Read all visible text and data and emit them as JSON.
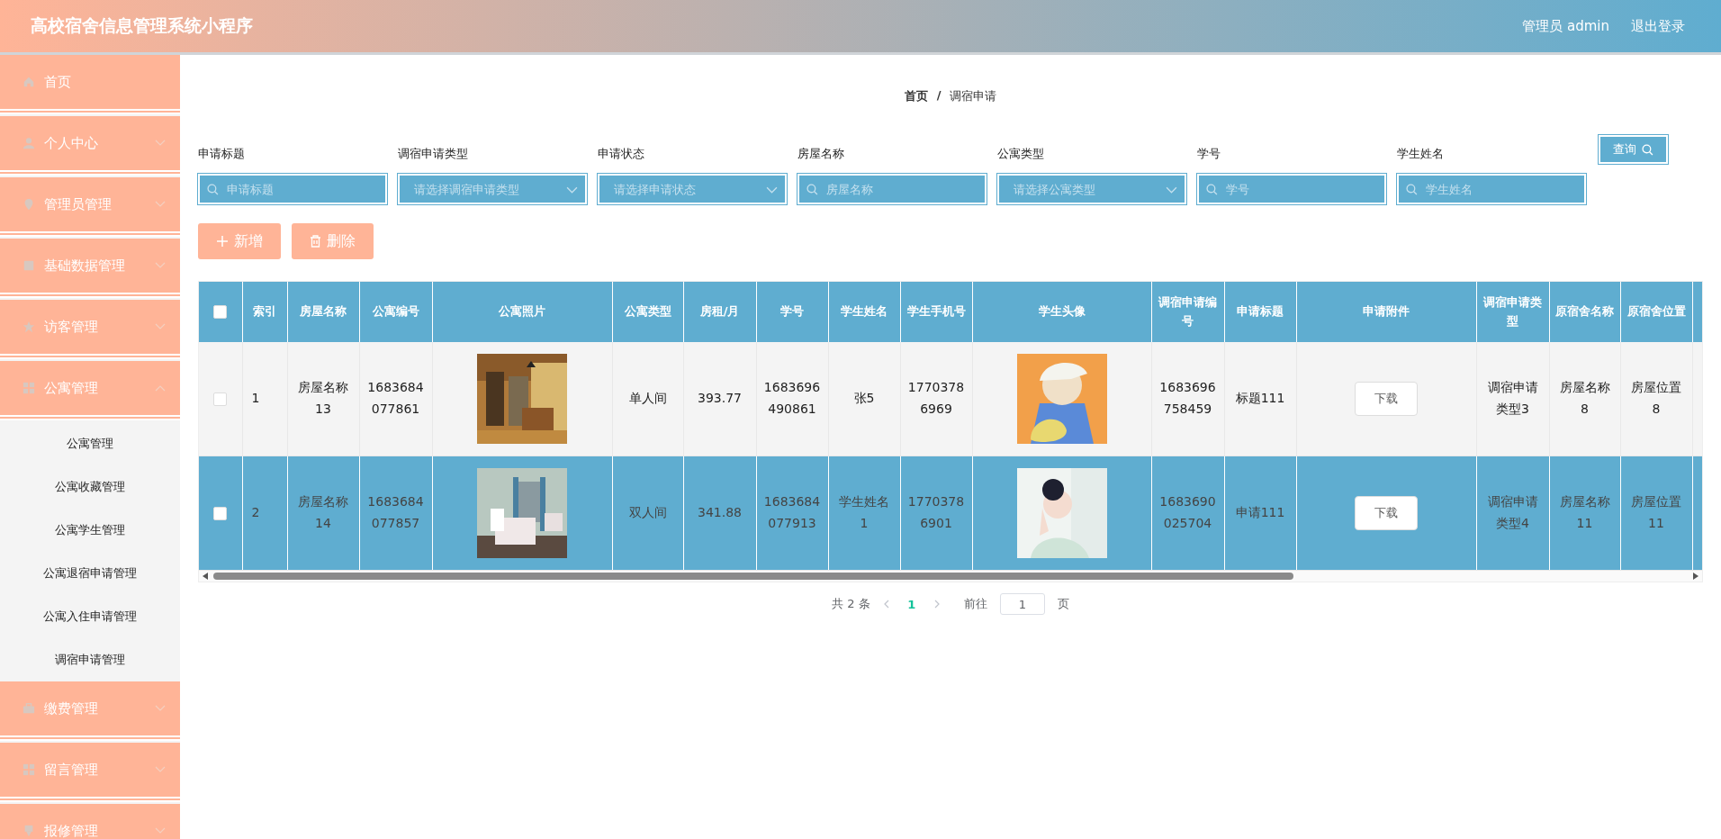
{
  "header": {
    "title": "高校宿舍信息管理系统小程序",
    "user": "管理员 admin",
    "logout": "退出登录"
  },
  "sidebar": {
    "items": [
      {
        "label": "首页"
      },
      {
        "label": "个人中心",
        "expanded": false
      },
      {
        "label": "管理员管理",
        "expanded": false
      },
      {
        "label": "基础数据管理",
        "expanded": false
      },
      {
        "label": "访客管理",
        "expanded": false
      },
      {
        "label": "公寓管理",
        "expanded": true,
        "children": [
          {
            "label": "公寓管理"
          },
          {
            "label": "公寓收藏管理"
          },
          {
            "label": "公寓学生管理"
          },
          {
            "label": "公寓退宿申请管理"
          },
          {
            "label": "公寓入住申请管理"
          },
          {
            "label": "调宿申请管理"
          }
        ]
      },
      {
        "label": "缴费管理",
        "expanded": false
      },
      {
        "label": "留言管理",
        "expanded": false
      },
      {
        "label": "报修管理",
        "expanded": false
      }
    ]
  },
  "breadcrumb": [
    "首页",
    "调宿申请"
  ],
  "breadcrumb_separator": "/",
  "filters": [
    {
      "label": "申请标题",
      "kind": "input",
      "placeholder": "申请标题"
    },
    {
      "label": "调宿申请类型",
      "kind": "select",
      "placeholder": "请选择调宿申请类型"
    },
    {
      "label": "申请状态",
      "kind": "select",
      "placeholder": "请选择申请状态"
    },
    {
      "label": "房屋名称",
      "kind": "input",
      "placeholder": "房屋名称"
    },
    {
      "label": "公寓类型",
      "kind": "select",
      "placeholder": "请选择公寓类型"
    },
    {
      "label": "学号",
      "kind": "input",
      "placeholder": "学号"
    },
    {
      "label": "学生姓名",
      "kind": "input",
      "placeholder": "学生姓名"
    }
  ],
  "query_button": "查询",
  "actions": [
    {
      "label": "新增",
      "kind": "add"
    },
    {
      "label": "删除",
      "kind": "delete"
    }
  ],
  "table": {
    "select_all_checked": false,
    "columns": [
      "索引",
      "房屋名称",
      "公寓编号",
      "公寓照片",
      "公寓类型",
      "房租/月",
      "学号",
      "学生姓名",
      "学生手机号",
      "学生头像",
      "调宿申请编号",
      "申请标题",
      "申请附件",
      "调宿申请类型",
      "原宿舍名称",
      "原宿舍位置"
    ],
    "rows": [
      {
        "highlighted": false,
        "checked": false,
        "cells": [
          "1",
          "房屋名称13",
          "1683684077861",
          {
            "kind": "picture"
          },
          "单人间",
          "393.77",
          "1683696490861",
          "张5",
          "17703786969",
          {
            "kind": "picture"
          },
          "1683696758459",
          "标题111",
          {
            "kind": "button",
            "label": "下载"
          },
          "调宿申请类型3",
          "房屋名称8",
          "房屋位置8"
        ]
      },
      {
        "highlighted": true,
        "checked": false,
        "cells": [
          "2",
          "房屋名称14",
          "1683684077857",
          {
            "kind": "picture"
          },
          "双人间",
          "341.88",
          "1683684077913",
          "学生姓名1",
          "17703786901",
          {
            "kind": "picture"
          },
          "1683690025704",
          "申请111",
          {
            "kind": "button",
            "label": "下载"
          },
          "调宿申请类型4",
          "房屋名称11",
          "房屋位置11"
        ]
      }
    ]
  },
  "pagination": {
    "total": "共 2 条",
    "pages": [
      {
        "label": "1",
        "selected": true
      }
    ],
    "goto": "前往",
    "page_input": "1",
    "page_unit": "页"
  }
}
